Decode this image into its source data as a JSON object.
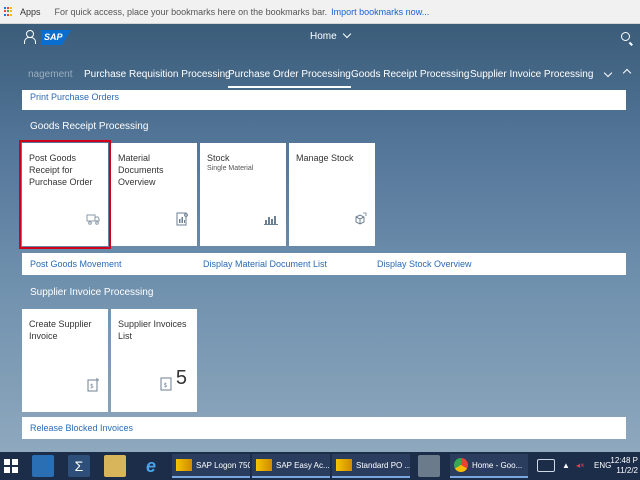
{
  "bookmarks": {
    "apps_label": "Apps",
    "hint": "For quick access, place your bookmarks here on the bookmarks bar.",
    "import_link": "Import bookmarks now..."
  },
  "shell": {
    "logo": "SAP",
    "title": "Home"
  },
  "anchor_nav": {
    "items": [
      {
        "label": "nagement"
      },
      {
        "label": "Purchase Requisition Processing"
      },
      {
        "label": "Purchase Order Processing"
      },
      {
        "label": "Goods Receipt Processing"
      },
      {
        "label": "Supplier Invoice Processing"
      }
    ]
  },
  "po_links": [
    "Print Purchase Orders"
  ],
  "goods_receipt": {
    "title": "Goods Receipt Processing",
    "tiles": [
      {
        "title": "Post Goods Receipt for Purchase Order",
        "subtitle": "",
        "icon": "truck-icon"
      },
      {
        "title": "Material Documents Overview",
        "subtitle": "",
        "icon": "document-report-icon"
      },
      {
        "title": "Stock",
        "subtitle": "Single Material",
        "icon": "bar-chart-icon"
      },
      {
        "title": "Manage Stock",
        "subtitle": "",
        "icon": "stock-cube-icon"
      }
    ],
    "links": [
      "Post Goods Movement",
      "Display Material Document List",
      "Display Stock Overview"
    ]
  },
  "supplier_invoice": {
    "title": "Supplier Invoice Processing",
    "tiles": [
      {
        "title": "Create Supplier Invoice",
        "icon": "invoice-add-icon"
      },
      {
        "title": "Supplier Invoices List",
        "icon": "invoice-icon",
        "count": "5"
      }
    ],
    "links": [
      "Release Blocked Invoices"
    ]
  },
  "taskbar": {
    "buttons": [
      "SAP Logon 750",
      "SAP Easy Ac...",
      "Standard PO ...",
      "Home - Goo..."
    ],
    "lang": "ENG",
    "time": "12:48 P",
    "date": "11/2/2"
  },
  "colors": {
    "accent": "#0a6ed1",
    "selection": "#d0021b",
    "link": "#2a6bb5"
  }
}
